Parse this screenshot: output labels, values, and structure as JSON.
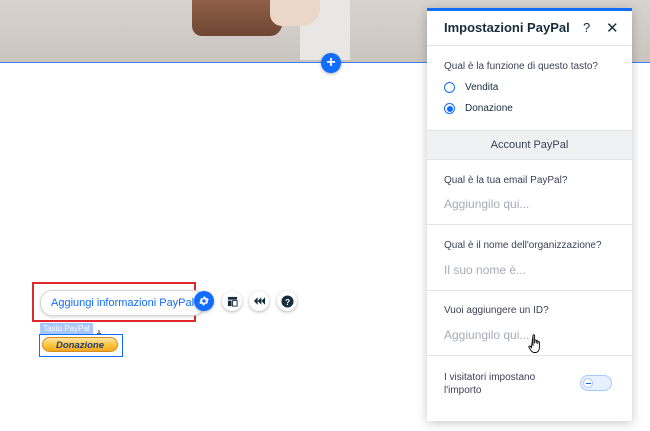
{
  "canvas": {
    "paypal_button_label": "Aggiungi informazioni PayPal",
    "selection_label": "Tasto PayPal",
    "donate_button_label": "Donazione",
    "accent_color": "#116dff",
    "highlight_color": "#e0282e"
  },
  "toolbar": {
    "icons": [
      "gear-icon",
      "layout-icon",
      "animation-icon",
      "help-icon"
    ]
  },
  "panel": {
    "title": "Impostazioni PayPal",
    "help_label": "?",
    "close_label": "✕",
    "function_question": "Qual è la funzione di questo tasto?",
    "options": [
      {
        "label": "Vendita",
        "selected": false
      },
      {
        "label": "Donazione",
        "selected": true
      }
    ],
    "account_section_title": "Account PayPal",
    "email_question": "Qual è la tua email PayPal?",
    "email_placeholder": "Aggiungilo qui...",
    "org_question": "Qual è il nome dell'organizzazione?",
    "org_placeholder": "Il suo nome è...",
    "id_question": "Vuoi aggiungere un ID?",
    "id_placeholder": "Aggiungilo qui...",
    "visitor_amount_label": "I visitatori impostano l'importo",
    "visitor_amount_enabled": false
  }
}
